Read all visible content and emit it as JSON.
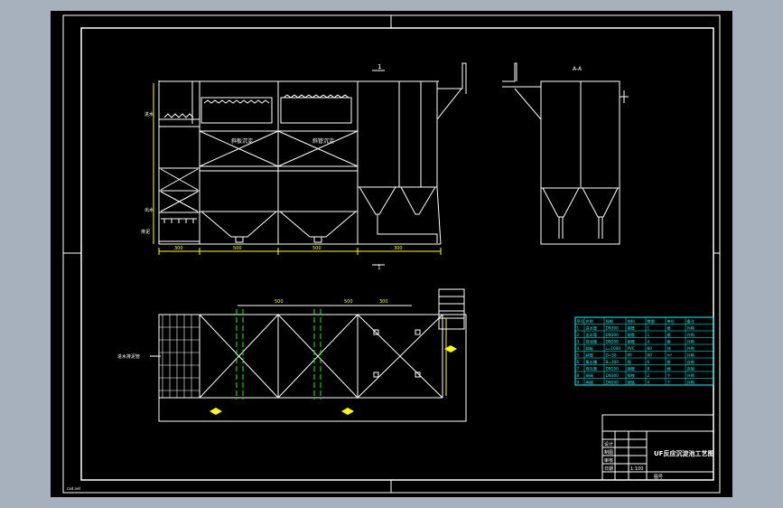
{
  "colors": {
    "workspace": "#a7b0bd",
    "canvas": "#000000",
    "line": "#ffffff",
    "dimension": "#ffff00",
    "annotation": "#00ffff",
    "pipe": "#00ff00",
    "title_text": "#ffffff"
  },
  "elevation": {
    "section_mark": "1",
    "left_labels": [
      "进水",
      "出水",
      "排泥"
    ],
    "chamber_labels": [
      "斜板沉淀",
      "斜管沉淀"
    ],
    "dimensions": [
      "300",
      "500",
      "500",
      "300"
    ],
    "bottom_mark": "1"
  },
  "side_view": {
    "section_mark": "A-A"
  },
  "plan": {
    "dimensions": [
      "500",
      "500",
      "300"
    ],
    "left_label": "进水排泥管"
  },
  "material_table": {
    "headers": [
      "序号",
      "名称",
      "规格",
      "材料",
      "数量",
      "单位",
      "备注"
    ],
    "rows": [
      [
        "1",
        "进水管",
        "DN300",
        "钢管",
        "1",
        "根",
        "外购"
      ],
      [
        "2",
        "出水管",
        "DN300",
        "钢管",
        "1",
        "根",
        "外购"
      ],
      [
        "3",
        "排泥管",
        "DN200",
        "钢管",
        "4",
        "根",
        "外购"
      ],
      [
        "4",
        "斜板",
        "L=1000",
        "PVC",
        "80",
        "块",
        "外购"
      ],
      [
        "5",
        "斜管",
        "D=50",
        "PP",
        "60",
        "m²",
        "外购"
      ],
      [
        "6",
        "集水槽",
        "B=300",
        "钢",
        "6",
        "根",
        "自制"
      ],
      [
        "7",
        "穿孔管",
        "DN150",
        "钢管",
        "8",
        "根",
        "自制"
      ],
      [
        "8",
        "闸阀",
        "DN300",
        "铸铁",
        "2",
        "个",
        "外购"
      ],
      [
        "9",
        "闸阀",
        "DN200",
        "铸铁",
        "4",
        "个",
        "外购"
      ]
    ]
  },
  "title_block": {
    "drawing_title": "UF反应沉淀池工艺图",
    "scale": "1:100",
    "row_labels": [
      "设计",
      "制图",
      "审核",
      "日期"
    ],
    "sheet": "图号"
  },
  "watermark": "cad.net"
}
